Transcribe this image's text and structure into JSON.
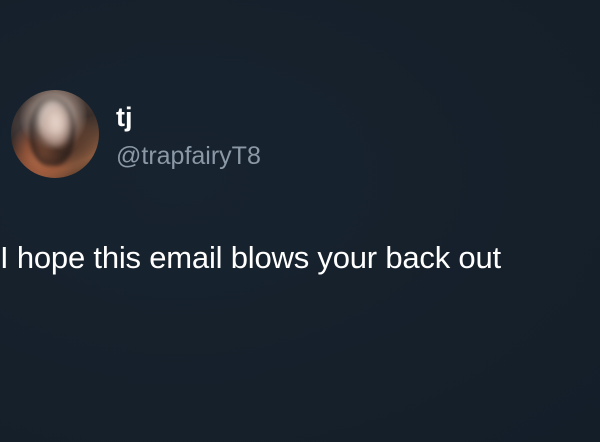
{
  "tweet": {
    "author": {
      "display_name": "tj",
      "handle": "@trapfairyT8"
    },
    "text": "I hope this email blows your back out"
  }
}
